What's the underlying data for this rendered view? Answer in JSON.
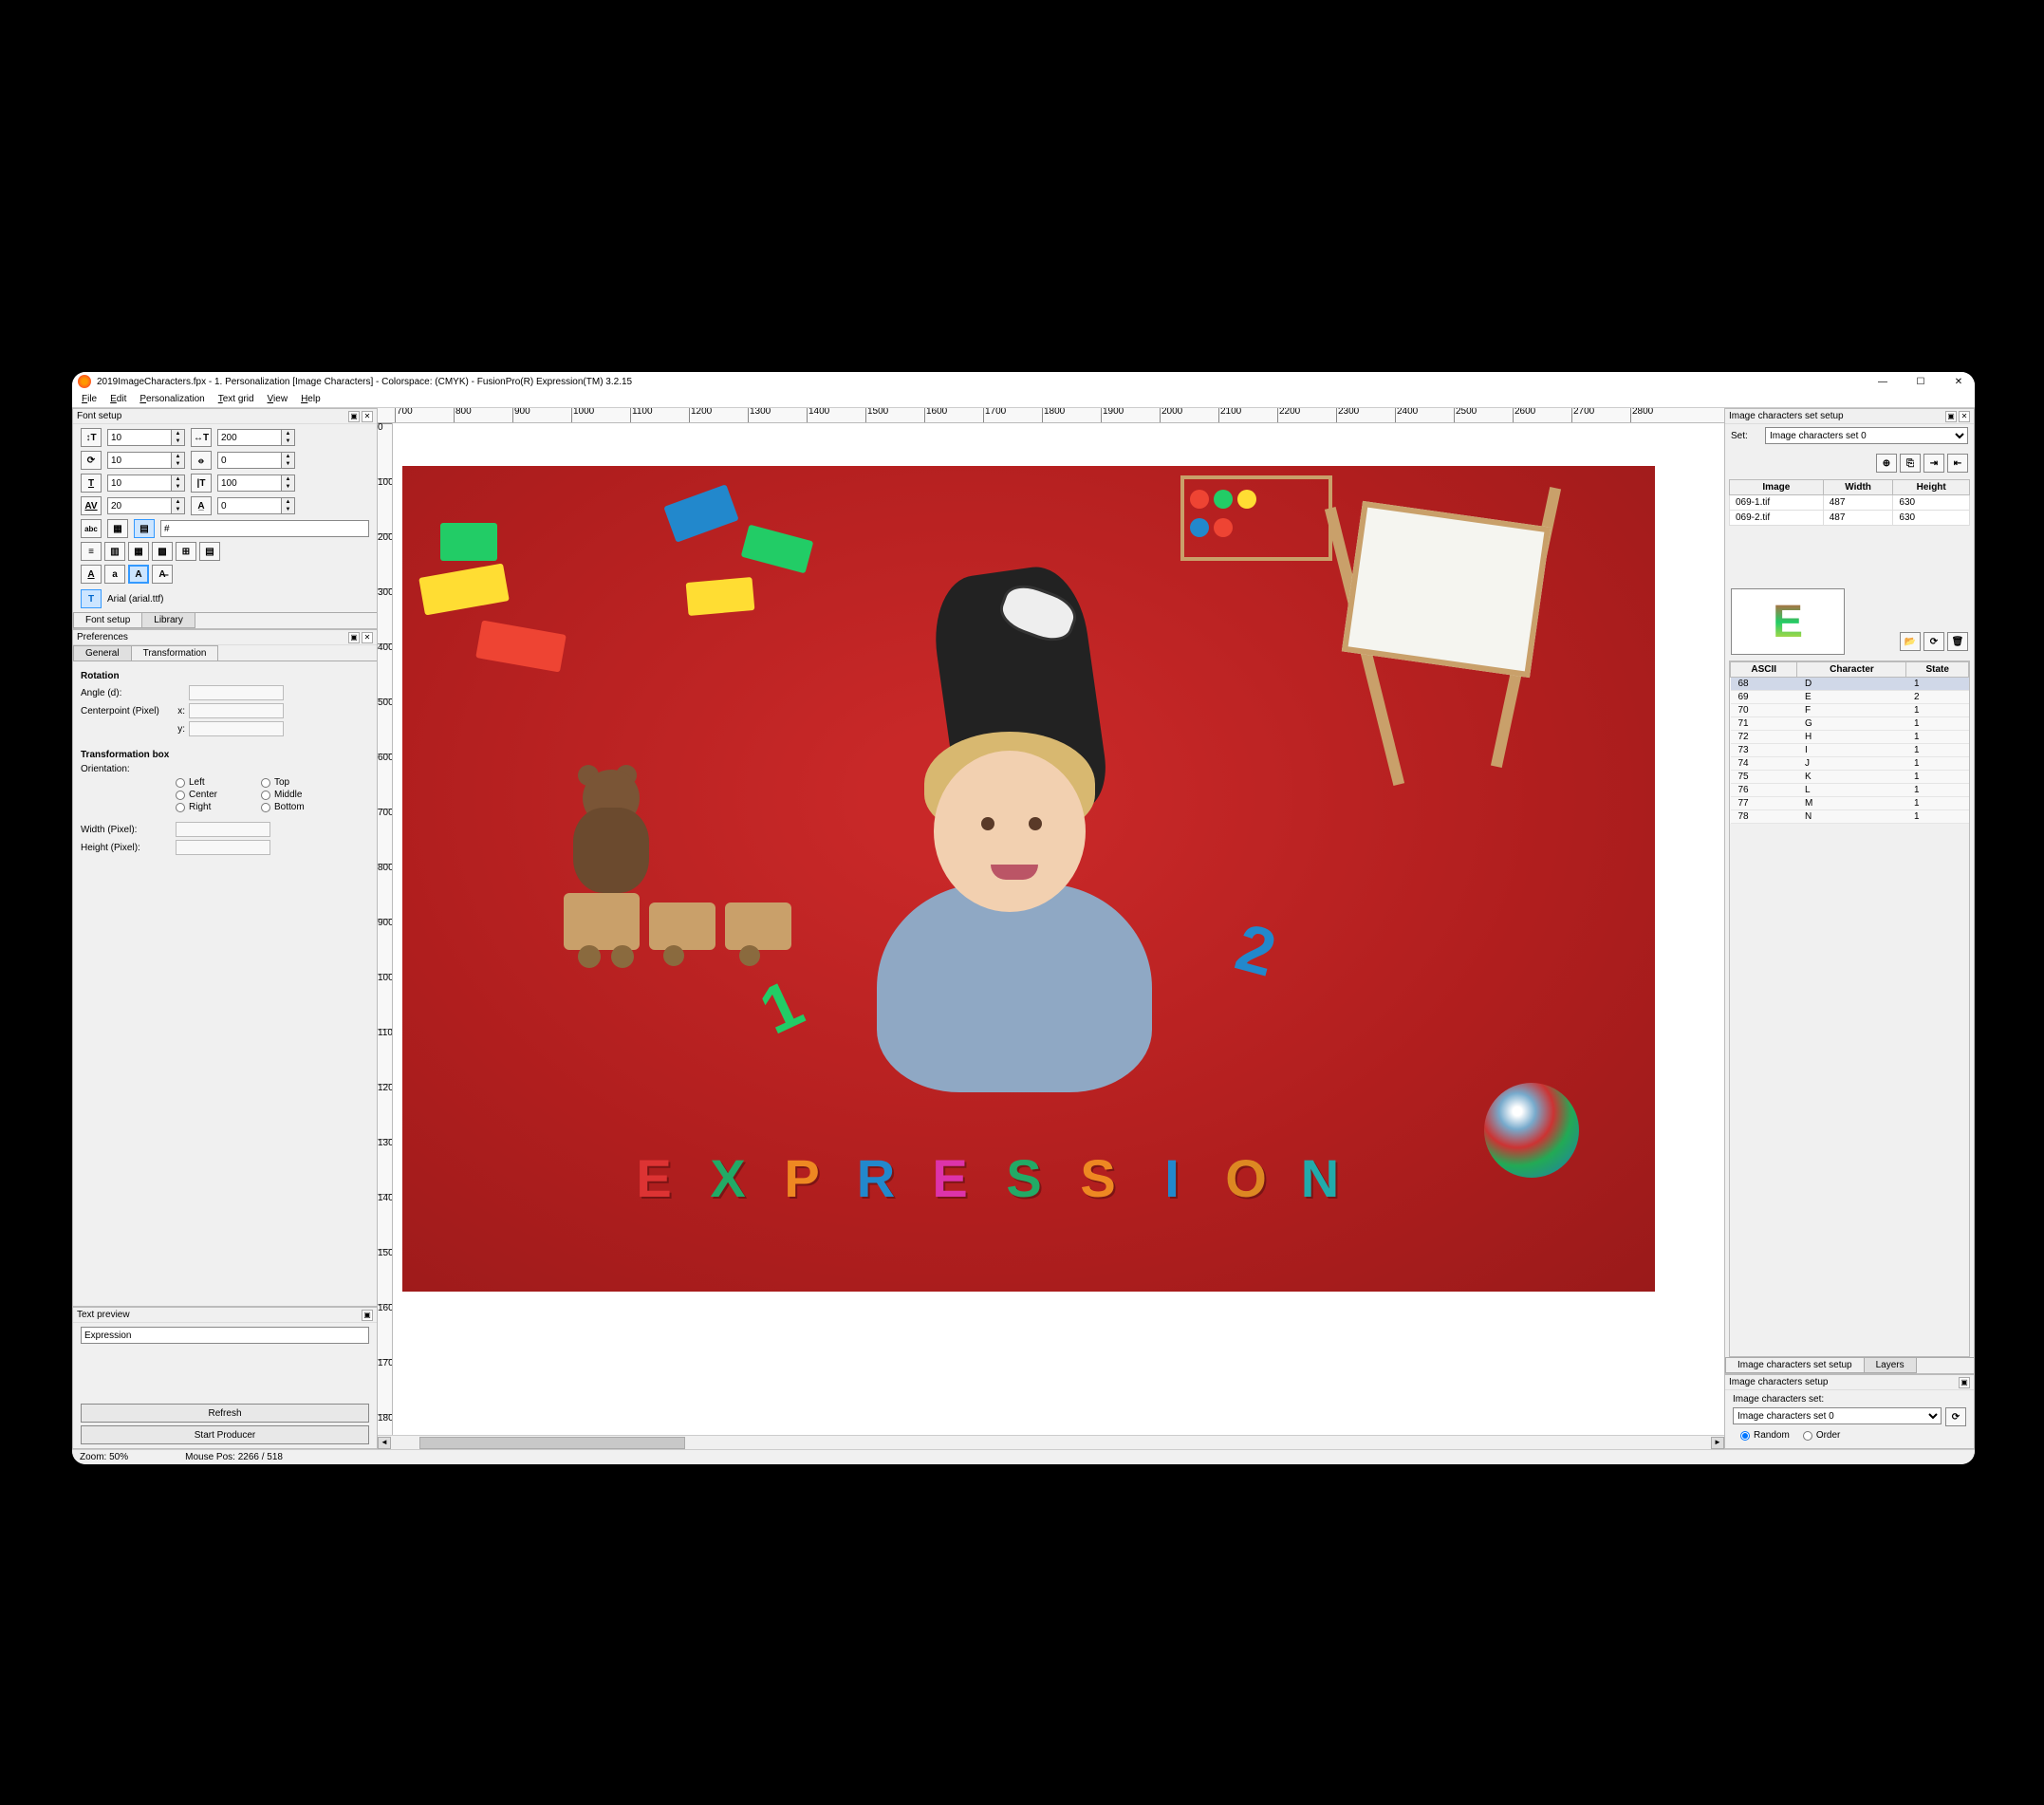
{
  "titlebar": {
    "title": "2019ImageCharacters.fpx - 1. Personalization [Image Characters] - Colorspace: (CMYK) - FusionPro(R) Expression(TM) 3.2.15"
  },
  "menu": [
    "File",
    "Edit",
    "Personalization",
    "Text grid",
    "View",
    "Help"
  ],
  "menu_underline_idx": [
    0,
    0,
    0,
    0,
    0,
    0
  ],
  "font_setup": {
    "title": "Font setup",
    "r1": {
      "a": "10",
      "b": "200"
    },
    "r2": {
      "a": "10",
      "b": "0"
    },
    "r3": {
      "a": "10",
      "b": "100"
    },
    "r4": {
      "a": "20",
      "b": "0"
    },
    "hash": "#",
    "font_name": "Arial (arial.ttf)",
    "tabs": [
      "Font setup",
      "Library"
    ]
  },
  "prefs": {
    "title": "Preferences",
    "tabs": [
      "General",
      "Transformation"
    ],
    "rotation": "Rotation",
    "angle": "Angle (d):",
    "centerpoint": "Centerpoint (Pixel)",
    "x": "x:",
    "y": "y:",
    "tbox": "Transformation box",
    "orientation": "Orientation:",
    "radios": [
      "Left",
      "Top",
      "Center",
      "Middle",
      "Right",
      "Bottom"
    ],
    "width": "Width (Pixel):",
    "height": "Height (Pixel):"
  },
  "text_preview": {
    "title": "Text preview",
    "value": "Expression",
    "refresh": "Refresh",
    "start": "Start Producer"
  },
  "status": {
    "zoom": "Zoom: 50%",
    "mouse": "Mouse Pos: 2266 / 518"
  },
  "ruler_start": 700,
  "ruler_step": 100,
  "ruler_count": 22,
  "ruler_v_start": 0,
  "ruler_v_step": 100,
  "ruler_v_count": 19,
  "canvas_word": "EXPRESSION",
  "letter_colors": [
    "#d33",
    "#2a6",
    "#e82",
    "#28c",
    "#d3a",
    "#2a6",
    "#e82",
    "#28c",
    "#d82",
    "#2aa"
  ],
  "right": {
    "set_setup_title": "Image characters set setup",
    "set_label": "Set:",
    "set_value": "Image characters set 0",
    "img_table": {
      "headers": [
        "Image",
        "Width",
        "Height"
      ],
      "rows": [
        [
          "069-1.tif",
          "487",
          "630"
        ],
        [
          "069-2.tif",
          "487",
          "630"
        ]
      ]
    },
    "char_headers": [
      "ASCII",
      "Character",
      "State"
    ],
    "char_rows": [
      [
        "68",
        "D",
        "1"
      ],
      [
        "69",
        "E",
        "2"
      ],
      [
        "70",
        "F",
        "1"
      ],
      [
        "71",
        "G",
        "1"
      ],
      [
        "72",
        "H",
        "1"
      ],
      [
        "73",
        "I",
        "1"
      ],
      [
        "74",
        "J",
        "1"
      ],
      [
        "75",
        "K",
        "1"
      ],
      [
        "76",
        "L",
        "1"
      ],
      [
        "77",
        "M",
        "1"
      ],
      [
        "78",
        "N",
        "1"
      ]
    ],
    "tabs": [
      "Image characters set setup",
      "Layers"
    ],
    "setup_title": "Image characters setup",
    "setup_label": "Image characters set:",
    "setup_value": "Image characters set 0",
    "random": "Random",
    "order": "Order",
    "preview_glyph": "E"
  }
}
